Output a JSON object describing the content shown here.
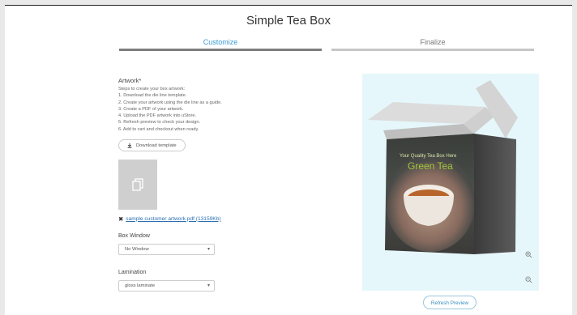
{
  "page": {
    "title": "Simple Tea Box"
  },
  "steps": [
    {
      "label": "Customize",
      "active": true
    },
    {
      "label": "Finalize",
      "active": false
    }
  ],
  "artwork": {
    "label": "Artwork*",
    "instructions": [
      "Steps to create your box artwork:",
      "1. Download the die line template.",
      "2. Create your artwork using the die line as a guide.",
      "3. Create a PDF of your artwork.",
      "4. Upload the PDF artwork into uStore.",
      "5. Refresh preview to check your design.",
      "6. Add to cart and checkout when ready."
    ],
    "download_label": "Download template",
    "file_name": "sample customer artwork.pdf (13159Kb)",
    "remove_symbol": "✖"
  },
  "box_window": {
    "label": "Box Window",
    "value": "No Window"
  },
  "lamination": {
    "label": "Lamination",
    "value": "gloss laminate"
  },
  "preview": {
    "box_text_1": "Your Quality Tea Box Here",
    "box_text_2": "Green Tea",
    "refresh_label": "Refresh Preview",
    "bg_color": "#e6f7fb"
  },
  "colors": {
    "accent": "#3a9bd1",
    "link": "#2a6fb0"
  }
}
